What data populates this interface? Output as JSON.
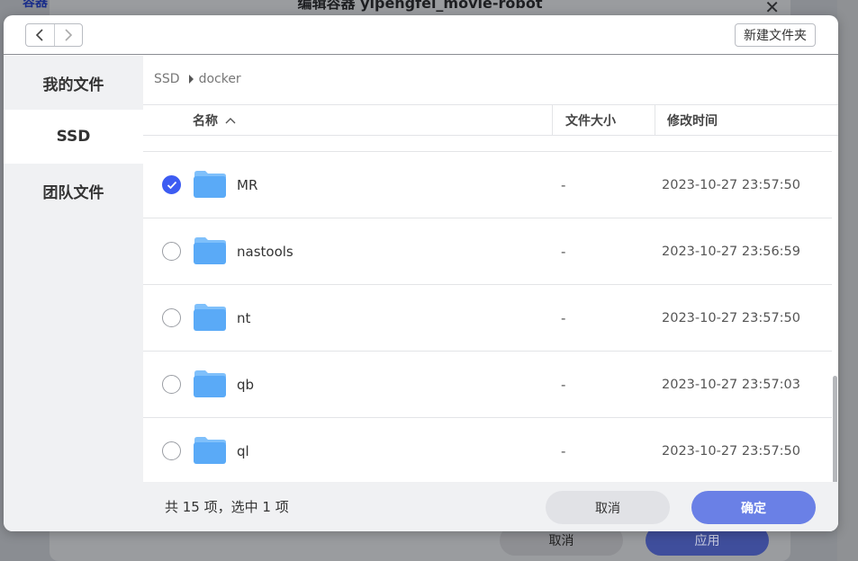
{
  "background": {
    "dialog_title": "编辑容器 yipengfei_movie-robot",
    "tab_label": "容器",
    "cancel_label": "取消",
    "apply_label": "应用"
  },
  "toolbar": {
    "new_folder_label": "新建文件夹"
  },
  "sidebar": {
    "items": [
      {
        "label": "我的文件"
      },
      {
        "label": "SSD"
      },
      {
        "label": "团队文件"
      }
    ]
  },
  "breadcrumb": {
    "root": "SSD",
    "current": "docker"
  },
  "table": {
    "columns": {
      "name": "名称",
      "size": "文件大小",
      "modified": "修改时间"
    },
    "rows": [
      {
        "name": "MR",
        "size": "-",
        "modified": "2023-10-27 23:57:50",
        "selected": true
      },
      {
        "name": "nastools",
        "size": "-",
        "modified": "2023-10-27 23:56:59",
        "selected": false
      },
      {
        "name": "nt",
        "size": "-",
        "modified": "2023-10-27 23:57:50",
        "selected": false
      },
      {
        "name": "qb",
        "size": "-",
        "modified": "2023-10-27 23:57:03",
        "selected": false
      },
      {
        "name": "ql",
        "size": "-",
        "modified": "2023-10-27 23:57:50",
        "selected": false
      }
    ]
  },
  "footer": {
    "summary": "共 15 项，选中 1 项",
    "cancel_label": "取消",
    "ok_label": "确定"
  },
  "colors": {
    "accent": "#3d5cf2",
    "primary_button": "#6a80e6",
    "folder": "#5aaaf7"
  }
}
